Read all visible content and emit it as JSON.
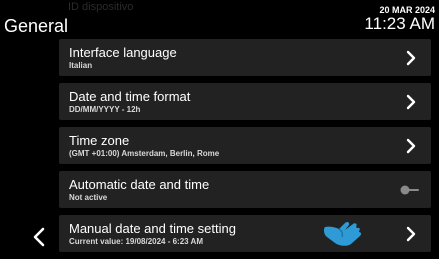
{
  "header": {
    "ghost_text": "ID dispositivo",
    "title": "General",
    "date": "20 MAR 2024",
    "time": "11:23 AM"
  },
  "settings": [
    {
      "label": "Interface language",
      "value": "Italian",
      "control": "chevron"
    },
    {
      "label": "Date and time format",
      "value": "DD/MM/YYYY - 12h",
      "control": "chevron"
    },
    {
      "label": "Time zone",
      "value": "(GMT +01:00) Amsterdam, Berlin, Rome",
      "control": "chevron"
    },
    {
      "label": "Automatic date and time",
      "value": "Not active",
      "control": "toggle",
      "toggle_on": false
    },
    {
      "label": "Manual date and time setting",
      "value": "Current value: 19/08/2024 - 6:23 AM",
      "control": "chevron"
    }
  ],
  "icons": {
    "back": "chevron-left-icon",
    "row_arrow": "chevron-right-icon",
    "toggle": "toggle-off-icon",
    "cursor": "pointing-hand-icon"
  },
  "colors": {
    "background": "#000000",
    "row_background": "#222222",
    "text": "#ffffff",
    "hand_accent": "#2e9bd6",
    "toggle_off": "#8a8a8a"
  }
}
